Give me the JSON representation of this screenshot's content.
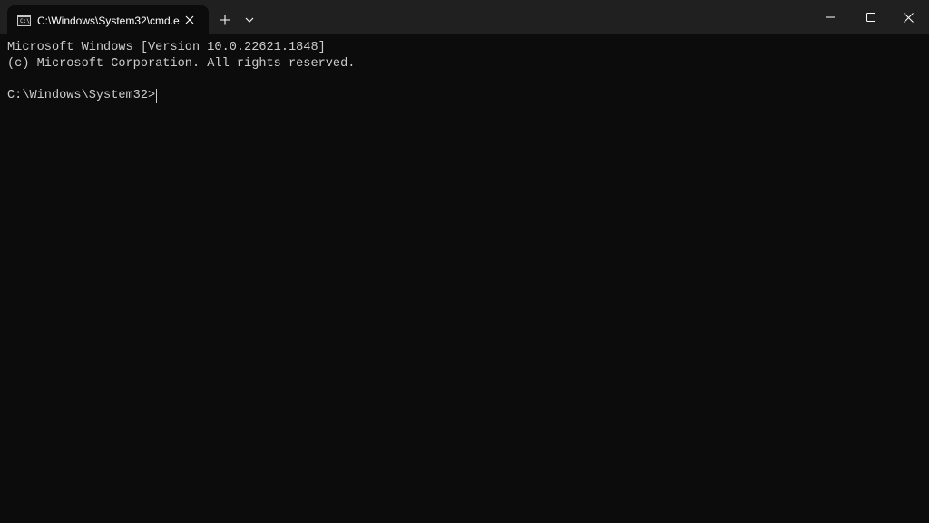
{
  "window": {
    "accent_background": "#0c0c0c",
    "titlebar_background": "#202020",
    "text_color": "#cccccc"
  },
  "tab": {
    "title": "C:\\Windows\\System32\\cmd.e",
    "icon": "command-prompt-icon",
    "icon_text": "C:\\",
    "close_icon": "close-icon"
  },
  "titlebar": {
    "new_tab_icon": "plus-icon",
    "dropdown_icon": "chevron-down-icon",
    "minimize_icon": "minimize-icon",
    "maximize_icon": "maximize-icon",
    "close_icon": "close-icon"
  },
  "terminal": {
    "lines": [
      "Microsoft Windows [Version 10.0.22621.1848]",
      "(c) Microsoft Corporation. All rights reserved."
    ],
    "prompt": "C:\\Windows\\System32>"
  }
}
